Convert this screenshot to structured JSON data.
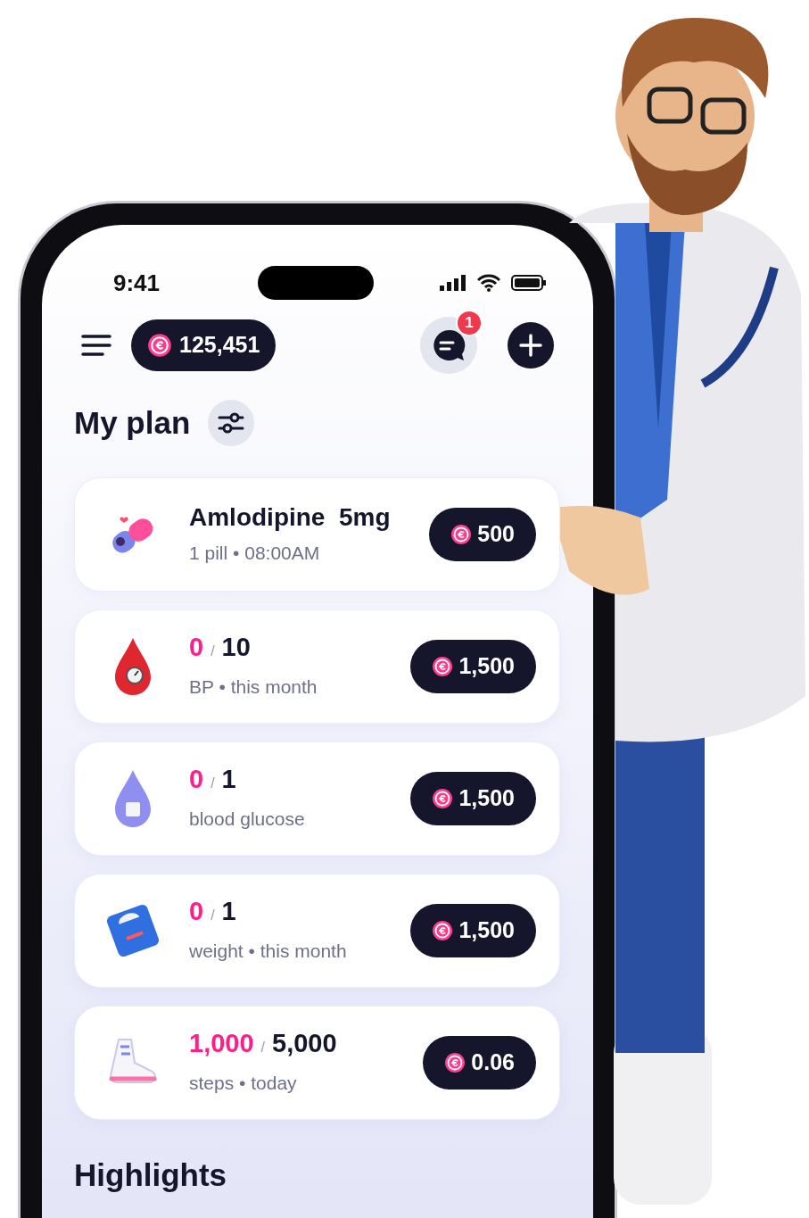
{
  "status_bar": {
    "time": "9:41"
  },
  "header": {
    "balance": "125,451",
    "notification_count": "1"
  },
  "plan": {
    "title": "My plan",
    "items": [
      {
        "kind": "medication",
        "name": "Amlodipine  5mg",
        "subtitle": "1 pill • 08:00AM",
        "reward": "500"
      },
      {
        "kind": "blood-pressure",
        "current": "0",
        "divider": "/",
        "target": "10",
        "subtitle": "BP • this month",
        "reward": "1,500"
      },
      {
        "kind": "glucose",
        "current": "0",
        "divider": "/",
        "target": "1",
        "subtitle": "blood glucose",
        "reward": "1,500"
      },
      {
        "kind": "weight",
        "current": "0",
        "divider": "/",
        "target": "1",
        "subtitle": "weight • this month",
        "reward": "1,500"
      },
      {
        "kind": "steps",
        "current": "1,000",
        "divider": "/",
        "target": "5,000",
        "subtitle": "steps • today",
        "reward": "0.06"
      }
    ]
  },
  "highlights": {
    "title": "Highlights"
  }
}
